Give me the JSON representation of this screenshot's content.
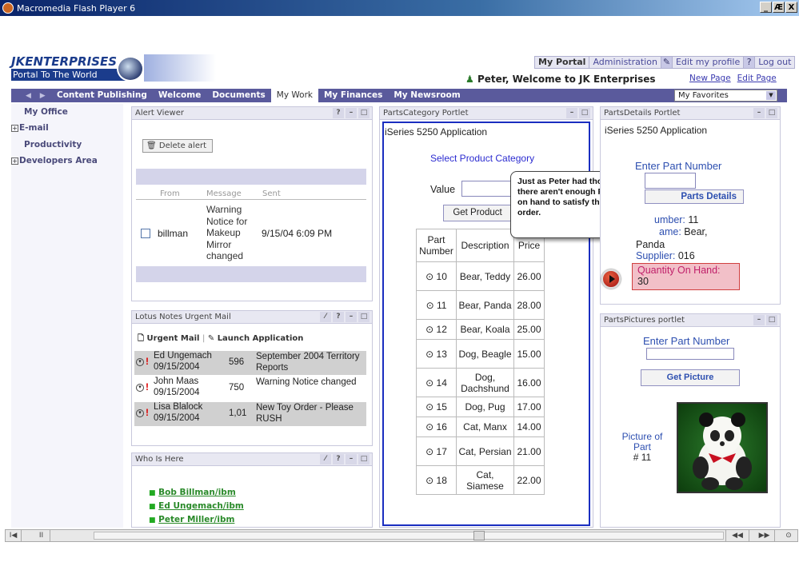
{
  "window": {
    "title": "Macromedia Flash Player 6",
    "min": "_",
    "max": "Æ",
    "close": "X"
  },
  "portal": {
    "logo_line1": "JKENTERPRISES",
    "logo_line2": "Portal To The World",
    "welcome": "Peter, Welcome to JK Enterprises",
    "new_page": "New Page",
    "edit_page": "Edit Page"
  },
  "toplinks": {
    "my_portal": "My Portal",
    "administration": "Administration",
    "edit_profile": "Edit my profile",
    "help": "?",
    "logout": "Log out"
  },
  "tabs": [
    "Content Publishing",
    "Welcome",
    "Documents",
    "My Work",
    "My Finances",
    "My Newsroom"
  ],
  "favorites": "My Favorites",
  "leftnav": [
    "My Office",
    "E-mail",
    "Productivity",
    "Developers Area"
  ],
  "alert_viewer": {
    "title": "Alert Viewer",
    "delete_btn": "Delete alert",
    "col_from": "From",
    "col_message": "Message",
    "col_sent": "Sent",
    "row": {
      "from": "billman",
      "message": "Warning Notice for Makeup Mirror changed",
      "sent": "9/15/04 6:09 PM"
    }
  },
  "lotus": {
    "title": "Lotus Notes Urgent Mail",
    "urgent": "Urgent Mail",
    "sep": "|",
    "launch": "Launch Application",
    "rows": [
      {
        "from": "Ed Ungemach",
        "date": "09/15/2004",
        "size": "596",
        "subject": "September 2004 Territory Reports"
      },
      {
        "from": "John Maas",
        "date": "09/15/2004",
        "size": "750",
        "subject": "Warning Notice changed"
      },
      {
        "from": "Lisa Blalock",
        "date": "09/15/2004",
        "size": "1,01",
        "subject": "New Toy Order - Please RUSH"
      }
    ]
  },
  "who": {
    "title": "Who Is Here",
    "people": [
      "Bob Billman/ibm",
      "Ed Ungemach/ibm",
      "Peter Miller/ibm"
    ]
  },
  "category": {
    "title": "PartsCategory Portlet",
    "app": "iSeries 5250 Application",
    "select": "Select Product Category",
    "value_label": "Value",
    "get_btn": "Get Product",
    "col_part": "Part Number",
    "col_desc": "Description",
    "col_price": "Price",
    "rows": [
      {
        "num": "10",
        "desc": "Bear, Teddy",
        "price": "26.00"
      },
      {
        "num": "11",
        "desc": "Bear, Panda",
        "price": "28.00"
      },
      {
        "num": "12",
        "desc": "Bear, Koala",
        "price": "25.00"
      },
      {
        "num": "13",
        "desc": "Dog, Beagle",
        "price": "15.00"
      },
      {
        "num": "14",
        "desc": "Dog, Dachshund",
        "price": "16.00"
      },
      {
        "num": "15",
        "desc": "Dog, Pug",
        "price": "17.00"
      },
      {
        "num": "16",
        "desc": "Cat, Manx",
        "price": "14.00"
      },
      {
        "num": "17",
        "desc": "Cat, Persian",
        "price": "21.00"
      },
      {
        "num": "18",
        "desc": "Cat, Siamese",
        "price": "22.00"
      }
    ]
  },
  "callout": "Just as Peter had thought, there aren't enough Pandas on hand to satisfy the RUSH order.",
  "details": {
    "title": "PartsDetails Portlet",
    "app": "iSeries 5250 Application",
    "enter": "Enter Part Number",
    "btn": "Parts Details",
    "number_label": "umber:",
    "number_val": "11",
    "name_label": "ame:",
    "name_val": "Bear,",
    "name_val2": "Panda",
    "supplier_label": "Supplier:",
    "supplier_val": "016",
    "qty_label": "Quantity On Hand:",
    "qty_val": "30"
  },
  "pictures": {
    "title": "PartsPictures portlet",
    "enter": "Enter Part Number",
    "btn": "Get Picture",
    "caption1": "Picture of",
    "caption2": "Part",
    "caption3": "# 11"
  }
}
